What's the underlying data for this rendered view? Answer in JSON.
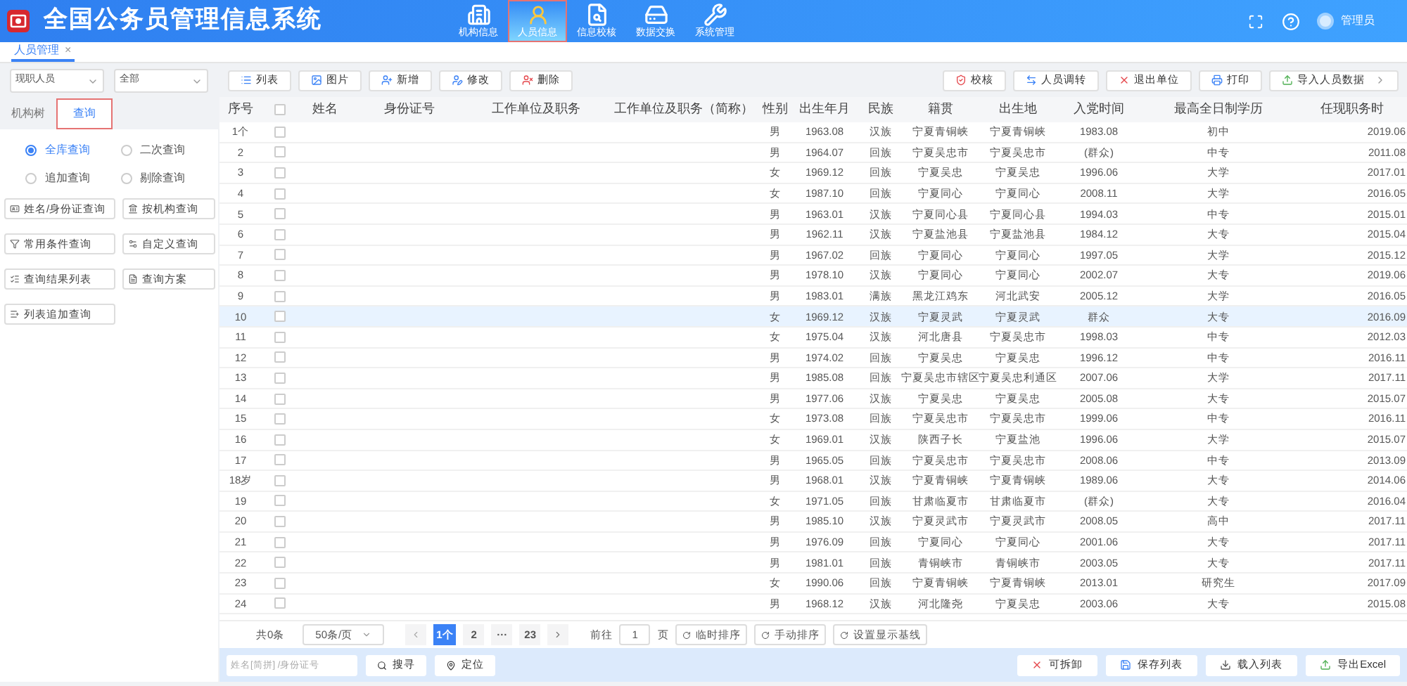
{
  "app": {
    "title": "全国公务员管理信息系统",
    "user": "管理员"
  },
  "nav": [
    {
      "label": "机构信息",
      "selected": false
    },
    {
      "label": "人员信息",
      "selected": true
    },
    {
      "label": "信息校核",
      "selected": false
    },
    {
      "label": "数据交换",
      "selected": false
    },
    {
      "label": "系统管理",
      "selected": false
    }
  ],
  "page_tabs": [
    {
      "label": "人员管理",
      "close": "×",
      "selected": true
    }
  ],
  "left": {
    "selects": [
      "现职人员",
      "全部"
    ],
    "tabs": [
      {
        "label": "机构树",
        "selected": false
      },
      {
        "label": "查询",
        "selected": true
      }
    ],
    "radios": [
      {
        "label": "全库查询",
        "selected": true
      },
      {
        "label": "二次查询",
        "selected": false
      },
      {
        "label": "追加查询",
        "selected": false
      },
      {
        "label": "剔除查询",
        "selected": false
      }
    ],
    "buttons": [
      "姓名/身份证查询",
      "按机构查询",
      "常用条件查询",
      "自定义查询",
      "查询结果列表",
      "查询方案",
      "列表追加查询"
    ]
  },
  "toolbar_left": [
    "列表",
    "图片",
    "新增",
    "修改",
    "删除"
  ],
  "toolbar_right": [
    "校核",
    "人员调转",
    "退出单位",
    "打印",
    "导入人员数据"
  ],
  "table": {
    "header_checked": false,
    "columns": [
      "序号",
      "",
      "姓名",
      "身份证号",
      "工作单位及职务",
      "工作单位及职务（简称）",
      "性别",
      "出生年月",
      "民族",
      "籍贯",
      "出生地",
      "入党时间",
      "最高全日制学历",
      "任现职务时"
    ],
    "rows": [
      {
        "cells": [
          "1个",
          "",
          "",
          "",
          "",
          "",
          "男",
          "1963.08",
          "汉族",
          "宁夏青铜峡",
          "宁夏青铜峡",
          "1983.08",
          "初中",
          "2019.06"
        ],
        "checked": false,
        "selected": false
      },
      {
        "cells": [
          "2",
          "",
          "",
          "",
          "",
          "",
          "男",
          "1964.07",
          "回族",
          "宁夏吴忠市",
          "宁夏吴忠市",
          "(群众)",
          "中专",
          "2011.08"
        ],
        "checked": false,
        "selected": false
      },
      {
        "cells": [
          "3",
          "",
          "",
          "",
          "",
          "",
          "女",
          "1969.12",
          "回族",
          "宁夏吴忠",
          "宁夏吴忠",
          "1996.06",
          "大学",
          "2017.01"
        ],
        "checked": false,
        "selected": false
      },
      {
        "cells": [
          "4",
          "",
          "",
          "",
          "",
          "",
          "女",
          "1987.10",
          "回族",
          "宁夏同心",
          "宁夏同心",
          "2008.11",
          "大学",
          "2016.05"
        ],
        "checked": false,
        "selected": false
      },
      {
        "cells": [
          "5",
          "",
          "",
          "",
          "",
          "",
          "男",
          "1963.01",
          "汉族",
          "宁夏同心县",
          "宁夏同心县",
          "1994.03",
          "中专",
          "2015.01"
        ],
        "checked": false,
        "selected": false
      },
      {
        "cells": [
          "6",
          "",
          "",
          "",
          "",
          "",
          "男",
          "1962.11",
          "汉族",
          "宁夏盐池县",
          "宁夏盐池县",
          "1984.12",
          "大专",
          "2015.04"
        ],
        "checked": false,
        "selected": false
      },
      {
        "cells": [
          "7",
          "",
          "",
          "",
          "",
          "",
          "男",
          "1967.02",
          "回族",
          "宁夏同心",
          "宁夏同心",
          "1997.05",
          "大学",
          "2015.12"
        ],
        "checked": false,
        "selected": false
      },
      {
        "cells": [
          "8",
          "",
          "",
          "",
          "",
          "",
          "男",
          "1978.10",
          "汉族",
          "宁夏同心",
          "宁夏同心",
          "2002.07",
          "大专",
          "2019.06"
        ],
        "checked": false,
        "selected": false
      },
      {
        "cells": [
          "9",
          "",
          "",
          "",
          "",
          "",
          "男",
          "1983.01",
          "满族",
          "黑龙江鸡东",
          "河北武安",
          "2005.12",
          "大学",
          "2016.05"
        ],
        "checked": false,
        "selected": false
      },
      {
        "cells": [
          "10",
          "",
          "",
          "",
          "",
          "",
          "女",
          "1969.12",
          "汉族",
          "宁夏灵武",
          "宁夏灵武",
          "群众",
          "大专",
          "2016.09"
        ],
        "checked": false,
        "selected": true
      },
      {
        "cells": [
          "11",
          "",
          "",
          "",
          "",
          "",
          "女",
          "1975.04",
          "汉族",
          "河北唐县",
          "宁夏吴忠市",
          "1998.03",
          "中专",
          "2012.03"
        ],
        "checked": false,
        "selected": false
      },
      {
        "cells": [
          "12",
          "",
          "",
          "",
          "",
          "",
          "男",
          "1974.02",
          "回族",
          "宁夏吴忠",
          "宁夏吴忠",
          "1996.12",
          "中专",
          "2016.11"
        ],
        "checked": false,
        "selected": false
      },
      {
        "cells": [
          "13",
          "",
          "",
          "",
          "",
          "",
          "男",
          "1985.08",
          "回族",
          "宁夏吴忠市辖区",
          "宁夏吴忠利通区",
          "2007.06",
          "大学",
          "2017.11"
        ],
        "checked": false,
        "selected": false
      },
      {
        "cells": [
          "14",
          "",
          "",
          "",
          "",
          "",
          "男",
          "1977.06",
          "汉族",
          "宁夏吴忠",
          "宁夏吴忠",
          "2005.08",
          "大专",
          "2015.07"
        ],
        "checked": false,
        "selected": false
      },
      {
        "cells": [
          "15",
          "",
          "",
          "",
          "",
          "",
          "女",
          "1973.08",
          "回族",
          "宁夏吴忠市",
          "宁夏吴忠市",
          "1999.06",
          "中专",
          "2016.11"
        ],
        "checked": false,
        "selected": false
      },
      {
        "cells": [
          "16",
          "",
          "",
          "",
          "",
          "",
          "女",
          "1969.01",
          "汉族",
          "陕西子长",
          "宁夏盐池",
          "1996.06",
          "大学",
          "2015.07"
        ],
        "checked": false,
        "selected": false
      },
      {
        "cells": [
          "17",
          "",
          "",
          "",
          "",
          "",
          "男",
          "1965.05",
          "回族",
          "宁夏吴忠市",
          "宁夏吴忠市",
          "2008.06",
          "中专",
          "2013.09"
        ],
        "checked": false,
        "selected": false
      },
      {
        "cells": [
          "18岁",
          "",
          "",
          "",
          "",
          "",
          "男",
          "1968.01",
          "汉族",
          "宁夏青铜峡",
          "宁夏青铜峡",
          "1989.06",
          "大专",
          "2014.06"
        ],
        "checked": false,
        "selected": false
      },
      {
        "cells": [
          "19",
          "",
          "",
          "",
          "",
          "",
          "女",
          "1971.05",
          "回族",
          "甘肃临夏市",
          "甘肃临夏市",
          "(群众)",
          "大专",
          "2016.04"
        ],
        "checked": false,
        "selected": false
      },
      {
        "cells": [
          "20",
          "",
          "",
          "",
          "",
          "",
          "男",
          "1985.10",
          "汉族",
          "宁夏灵武市",
          "宁夏灵武市",
          "2008.05",
          "高中",
          "2017.11"
        ],
        "checked": false,
        "selected": false
      },
      {
        "cells": [
          "21",
          "",
          "",
          "",
          "",
          "",
          "男",
          "1976.09",
          "回族",
          "宁夏同心",
          "宁夏同心",
          "2001.06",
          "大专",
          "2017.11"
        ],
        "checked": false,
        "selected": false
      },
      {
        "cells": [
          "22",
          "",
          "",
          "",
          "",
          "",
          "男",
          "1981.01",
          "回族",
          "青铜峡市",
          "青铜峡市",
          "2003.05",
          "大专",
          "2017.11"
        ],
        "checked": false,
        "selected": false
      },
      {
        "cells": [
          "23",
          "",
          "",
          "",
          "",
          "",
          "女",
          "1990.06",
          "回族",
          "宁夏青铜峡",
          "宁夏青铜峡",
          "2013.01",
          "研究生",
          "2017.09"
        ],
        "checked": false,
        "selected": false
      },
      {
        "cells": [
          "24",
          "",
          "",
          "",
          "",
          "",
          "男",
          "1968.12",
          "汉族",
          "河北隆尧",
          "宁夏吴忠",
          "2003.06",
          "大专",
          "2015.08"
        ],
        "checked": false,
        "selected": false
      }
    ]
  },
  "pagination": {
    "total": "共0条",
    "page_size": "50条/页",
    "pages": [
      {
        "label": "1个",
        "selected": true
      },
      {
        "label": "2",
        "selected": false
      },
      {
        "label": "···",
        "selected": false
      },
      {
        "label": "23",
        "selected": false
      }
    ],
    "goto": "前往",
    "goto_value": "1",
    "page_unit": "页",
    "buttons": [
      "临时排序",
      "手动排序",
      "设置显示基线"
    ]
  },
  "bottom": {
    "search_placeholder": "姓名[简拼] /身份证号",
    "buttons_left": [
      "搜寻",
      "定位"
    ],
    "buttons_right": [
      "可拆卸",
      "保存列表",
      "载入列表",
      "导出Excel"
    ]
  }
}
